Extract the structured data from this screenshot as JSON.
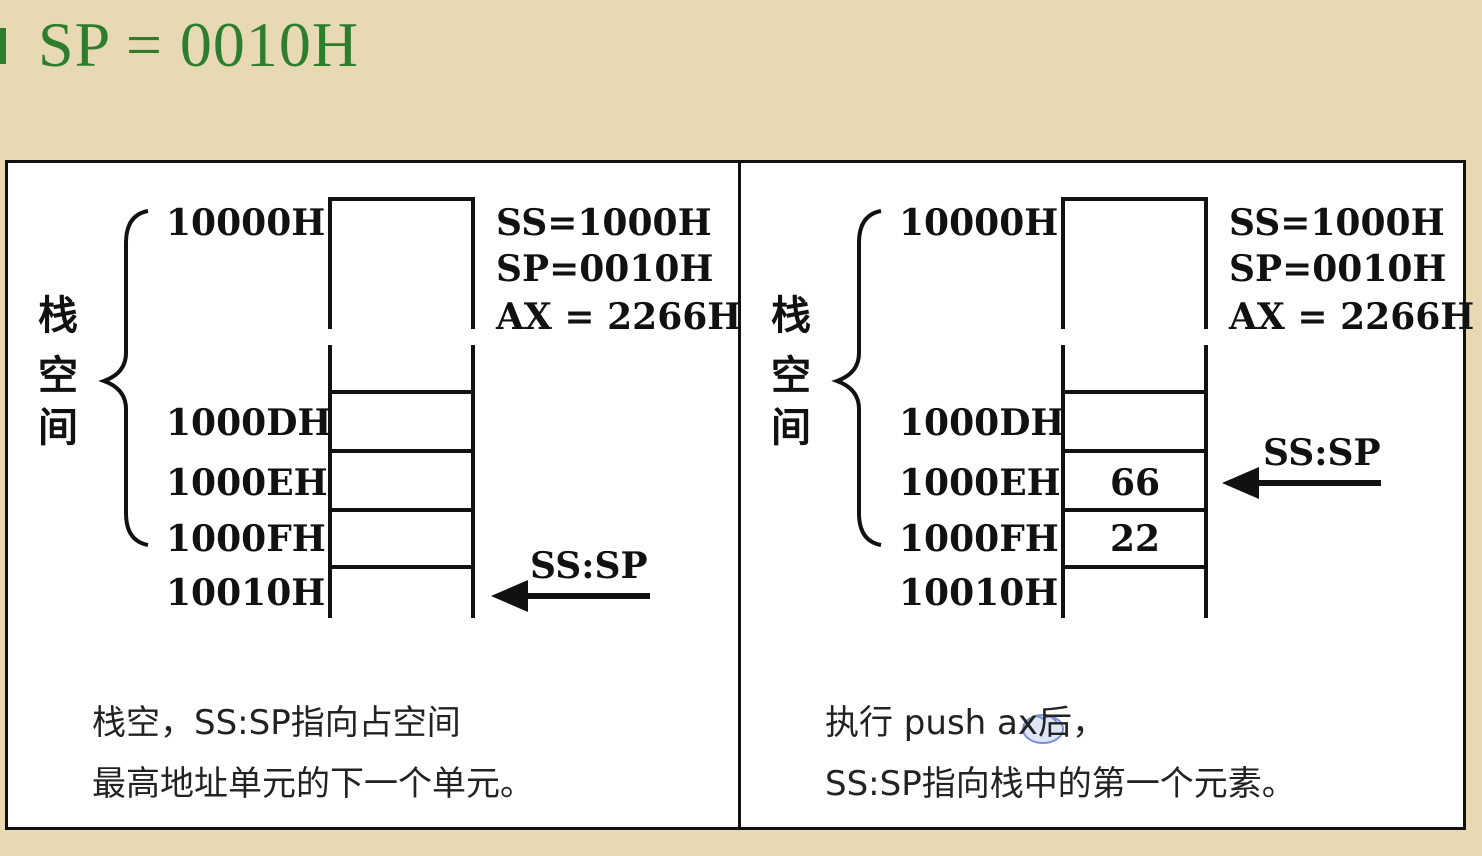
{
  "title": "SP = 0010H",
  "left": {
    "stack_label": [
      "栈",
      "空",
      "间"
    ],
    "addresses": [
      "10000H",
      "1000DH",
      "1000EH",
      "1000FH",
      "10010H"
    ],
    "registers": [
      "SS=1000H",
      "SP=0010H",
      "AX = 2266H"
    ],
    "cells": [
      "",
      "",
      ""
    ],
    "pointer_label": "SS:SP",
    "caption_line1": "栈空，SS:SP指向占空间",
    "caption_line2": "最高地址单元的下一个单元。"
  },
  "right": {
    "stack_label": [
      "栈",
      "空",
      "间"
    ],
    "addresses": [
      "10000H",
      "1000DH",
      "1000EH",
      "1000FH",
      "10010H"
    ],
    "registers": [
      "SS=1000H",
      "SP=0010H",
      "AX = 2266H"
    ],
    "cells": [
      "",
      "66",
      "22"
    ],
    "pointer_label": "SS:SP",
    "caption_line1": "执行 push ax后，",
    "caption_line2": "SS:SP指向栈中的第一个元素。"
  }
}
